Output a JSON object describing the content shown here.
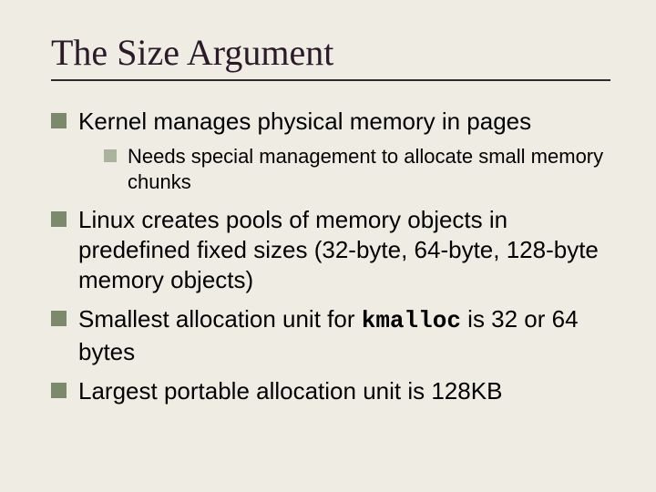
{
  "title": "The Size Argument",
  "bullets": [
    {
      "text": "Kernel manages physical memory in pages",
      "sub": [
        "Needs special management to allocate small memory chunks"
      ]
    },
    {
      "text": "Linux creates pools of memory objects in predefined fixed sizes (32-byte, 64-byte, 128-byte memory objects)"
    },
    {
      "pre": "Smallest allocation unit for ",
      "code": "kmalloc",
      "post": " is 32 or 64 bytes"
    },
    {
      "text": "Largest portable allocation unit is 128KB"
    }
  ]
}
